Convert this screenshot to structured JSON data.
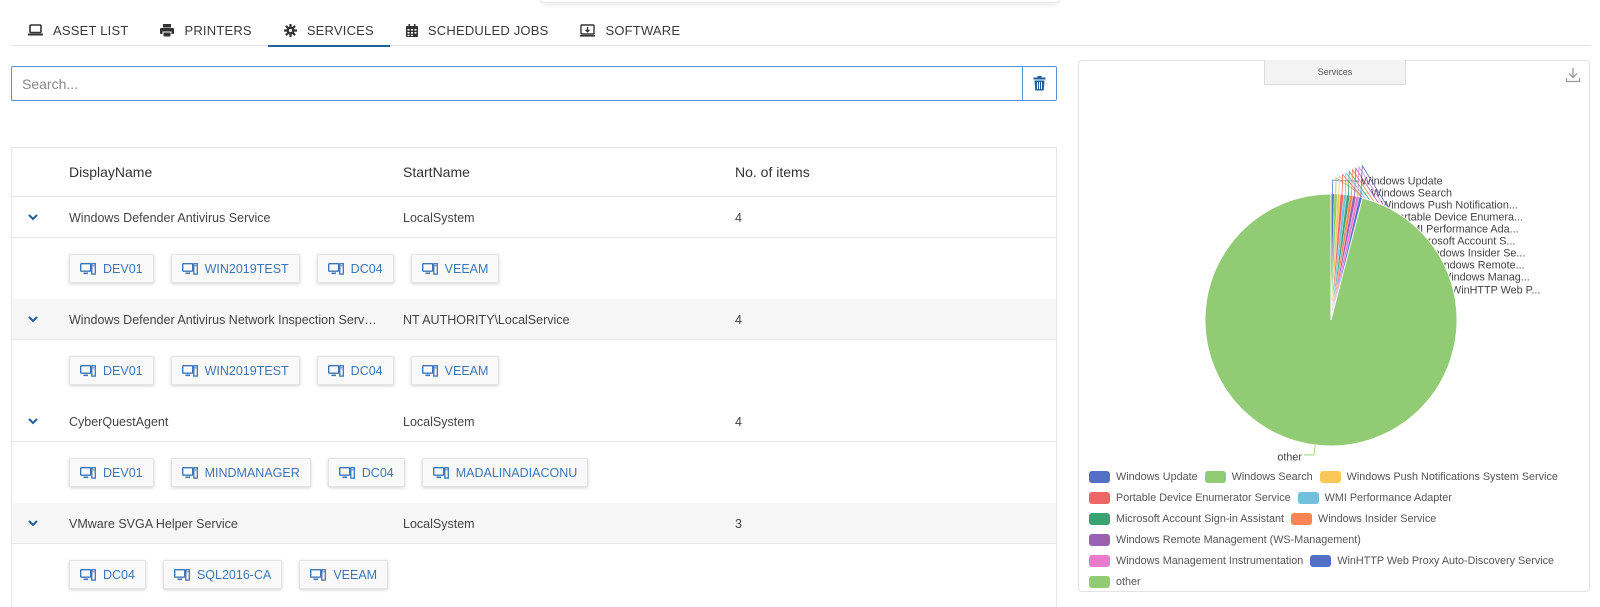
{
  "tabs": [
    {
      "label": "ASSET LIST",
      "icon": "laptop-icon",
      "active": false
    },
    {
      "label": "PRINTERS",
      "icon": "printer-icon",
      "active": false
    },
    {
      "label": "SERVICES",
      "icon": "gear-icon",
      "active": true
    },
    {
      "label": "SCHEDULED JOBS",
      "icon": "calendar-icon",
      "active": false
    },
    {
      "label": "SOFTWARE",
      "icon": "software-download-icon",
      "active": false
    }
  ],
  "search": {
    "placeholder": "Search...",
    "value": ""
  },
  "table": {
    "headers": {
      "name": "DisplayName",
      "start": "StartName",
      "count": "No. of items"
    },
    "rows": [
      {
        "name": "Windows Defender Antivirus Service",
        "start": "LocalSystem",
        "count": "4",
        "items": [
          "DEV01",
          "WIN2019TEST",
          "DC04",
          "VEEAM"
        ]
      },
      {
        "name": "Windows Defender Antivirus Network Inspection Serv…",
        "start": "NT AUTHORITY\\LocalService",
        "count": "4",
        "items": [
          "DEV01",
          "WIN2019TEST",
          "DC04",
          "VEEAM"
        ]
      },
      {
        "name": "CyberQuestAgent",
        "start": "LocalSystem",
        "count": "4",
        "items": [
          "DEV01",
          "MINDMANAGER",
          "DC04",
          "MADALINADIACONU"
        ]
      },
      {
        "name": "VMware SVGA Helper Service",
        "start": "LocalSystem",
        "count": "3",
        "items": [
          "DC04",
          "SQL2016-CA",
          "VEEAM"
        ]
      }
    ]
  },
  "chart": {
    "title": "Services",
    "colors": {
      "accent": "#1f5f9e",
      "chip_text": "#3d76b8"
    }
  },
  "chart_data": {
    "type": "pie",
    "title": "Services",
    "slices": [
      {
        "name": "Windows Update",
        "label": "Windows Update",
        "value": 0.4,
        "color": "#5470c6"
      },
      {
        "name": "Windows Search",
        "label": "Windows Search",
        "value": 0.4,
        "color": "#91cc75"
      },
      {
        "name": "Windows Push Notifications System Service",
        "label": "Windows Push Notification...",
        "value": 0.4,
        "color": "#fac858"
      },
      {
        "name": "Portable Device Enumerator Service",
        "label": "Portable Device Enumera...",
        "value": 0.4,
        "color": "#ee6666"
      },
      {
        "name": "WMI Performance Adapter",
        "label": "WMI Performance Ada...",
        "value": 0.4,
        "color": "#73c0de"
      },
      {
        "name": "Microsoft Account Sign-in Assistant",
        "label": "Microsoft Account S...",
        "value": 0.4,
        "color": "#3ba272"
      },
      {
        "name": "Windows Insider Service",
        "label": "Windows Insider Se...",
        "value": 0.4,
        "color": "#fc8452"
      },
      {
        "name": "Windows Remote Management (WS-Management)",
        "label": "Windows Remote...",
        "value": 0.4,
        "color": "#9a60b4"
      },
      {
        "name": "Windows Management Instrumentation",
        "label": "Windows Manag...",
        "value": 0.4,
        "color": "#ea7ccc"
      },
      {
        "name": "WinHTTP Web Proxy Auto-Discovery Service",
        "label": "WinHTTP Web P...",
        "value": 0.4,
        "color": "#5470c6"
      },
      {
        "name": "other",
        "label": "other",
        "value": 96.0,
        "color": "#91cc75"
      }
    ],
    "legend_placement": "bottom"
  }
}
